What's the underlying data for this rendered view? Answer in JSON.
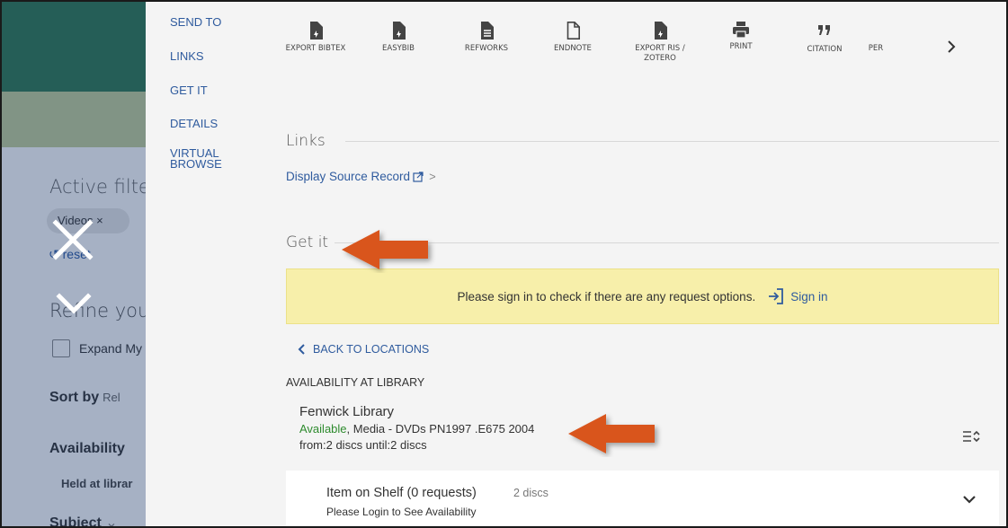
{
  "background": {
    "active_filters": "Active filte",
    "chip_label": "Videos",
    "chip_close": "×",
    "reset": "reset",
    "refine": "Refine you",
    "expand": "Expand My",
    "sort_by": "Sort by",
    "sort_value": "Rel",
    "availability": "Availability",
    "held_at": "Held at librar",
    "subject": "Subject",
    "subject_chevron": "⌄"
  },
  "section_nav": [
    "SEND TO",
    "LINKS",
    "GET IT",
    "DETAILS",
    "VIRTUAL BROWSE"
  ],
  "tools": [
    {
      "label": "EXPORT BIBTEX",
      "icon": "export-bibtex-icon"
    },
    {
      "label": "EASYBIB",
      "icon": "easybib-icon"
    },
    {
      "label": "REFWORKS",
      "icon": "refworks-icon"
    },
    {
      "label": "ENDNOTE",
      "icon": "endnote-icon"
    },
    {
      "label": "EXPORT RIS / ZOTERO",
      "icon": "export-ris-icon"
    },
    {
      "label": "PRINT",
      "icon": "print-icon"
    },
    {
      "label": "CITATION",
      "icon": "citation-icon"
    },
    {
      "label": "PER",
      "icon": "permalink-icon"
    }
  ],
  "links_section": {
    "title": "Links",
    "source_link": "Display Source Record",
    "chevron": ">"
  },
  "getit_section": {
    "title": "Get it",
    "banner_text": "Please sign in to check if there are any request options.",
    "sign_in": "Sign in",
    "back_to_locations": "BACK TO LOCATIONS",
    "availability_heading": "AVAILABILITY AT LIBRARY",
    "library_name": "Fenwick Library",
    "status": "Available",
    "location": ", Media - DVDs PN1997 .E675 2004",
    "from_until": "from:2 discs until:2 discs",
    "item_title": "Item on Shelf (0 requests)",
    "item_count": "2 discs",
    "item_note": "Please Login to See Availability"
  },
  "colors": {
    "link": "#2f5b9e",
    "available": "#2e8b2e",
    "banner": "#f7efaa",
    "arrow": "#d9541c"
  }
}
